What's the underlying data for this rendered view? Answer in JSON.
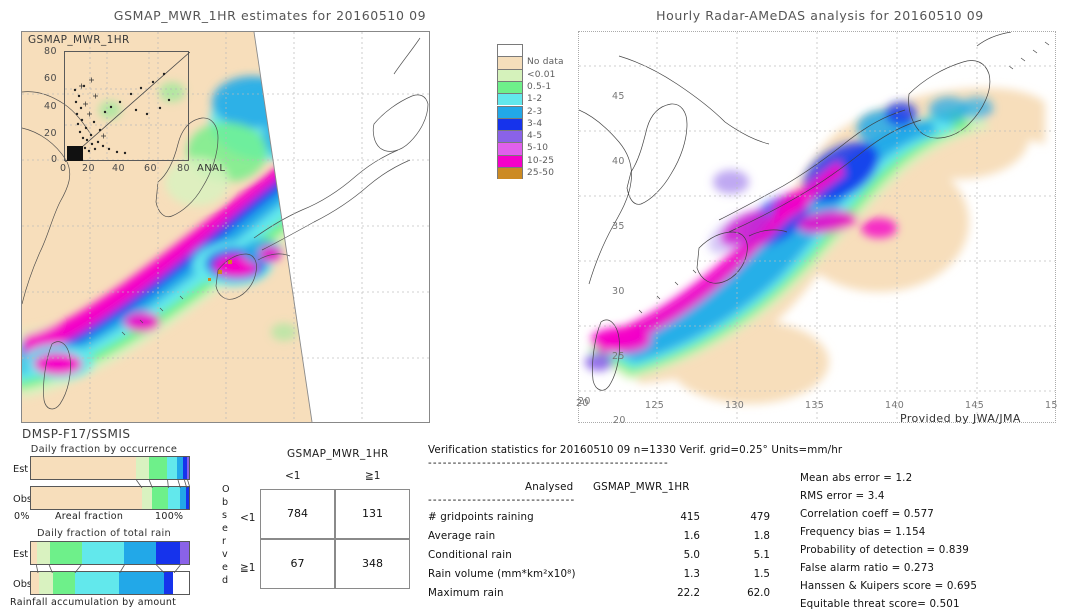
{
  "left_panel": {
    "title": "GSMAP_MWR_1HR estimates for 20160510 09",
    "inset_label": "GSMAP_MWR_1HR",
    "inset_xlabel": "ANAL",
    "inset_yticks": [
      "80",
      "60",
      "40",
      "20",
      "0"
    ],
    "inset_xticks": [
      "0",
      "20",
      "40",
      "60",
      "80"
    ],
    "sensor": "DMSP-F17/SSMIS"
  },
  "right_panel": {
    "title": "Hourly Radar-AMeDAS analysis for 20160510 09",
    "credit": "Provided by JWA/JMA",
    "lon_ticks": [
      "20",
      "125",
      "130",
      "135",
      "140",
      "145",
      "15"
    ],
    "lat_ticks": [
      "45",
      "40",
      "35",
      "30",
      "25",
      "20"
    ],
    "lat_bottom_extra": "20"
  },
  "colorbar": {
    "units": "mm/hr",
    "entries": [
      {
        "label": "",
        "color": "#ffffff"
      },
      {
        "label": "No data",
        "color": "#f5debb"
      },
      {
        "label": "<0.01",
        "color": "#d5f2bb"
      },
      {
        "label": "0.5-1",
        "color": "#6ef08a"
      },
      {
        "label": "1-2",
        "color": "#62e8ec"
      },
      {
        "label": "2-3",
        "color": "#22a8e8"
      },
      {
        "label": "3-4",
        "color": "#1633ec"
      },
      {
        "label": "4-5",
        "color": "#8a62e8"
      },
      {
        "label": "5-10",
        "color": "#e060ec"
      },
      {
        "label": "10-25",
        "color": "#f500c8"
      },
      {
        "label": "25-50",
        "color": "#cc8a22"
      }
    ]
  },
  "daily_fraction_occurrence": {
    "title": "Daily fraction by occurrence",
    "axis_left": "0%",
    "axis_center": "Areal fraction",
    "axis_right": "100%",
    "rows": [
      {
        "label": "Est",
        "segments": [
          {
            "color": "#f7debb",
            "width": 66.5
          },
          {
            "color": "#d9f2c0",
            "width": 8.0
          },
          {
            "color": "#6ef08a",
            "width": 11.5
          },
          {
            "color": "#62e8ec",
            "width": 6.5
          },
          {
            "color": "#22a8e8",
            "width": 4.0
          },
          {
            "color": "#1633ec",
            "width": 2.0
          },
          {
            "color": "#8a62e8",
            "width": 1.5
          }
        ]
      },
      {
        "label": "Obs",
        "segments": [
          {
            "color": "#f7debb",
            "width": 70.0
          },
          {
            "color": "#d9f2c0",
            "width": 6.5
          },
          {
            "color": "#6ef08a",
            "width": 10.0
          },
          {
            "color": "#62e8ec",
            "width": 7.5
          },
          {
            "color": "#22a8e8",
            "width": 4.0
          },
          {
            "color": "#1633ec",
            "width": 2.0
          }
        ]
      }
    ]
  },
  "daily_fraction_total_rain": {
    "title": "Daily fraction of total rain",
    "axis_bottom": "Rainfall accumulation by amount",
    "rows": [
      {
        "label": "Est",
        "segments": [
          {
            "color": "#f7debb",
            "width": 4.0
          },
          {
            "color": "#d9f2c0",
            "width": 8.0
          },
          {
            "color": "#6ef08a",
            "width": 20.0
          },
          {
            "color": "#62e8ec",
            "width": 27.0
          },
          {
            "color": "#22a8e8",
            "width": 20.0
          },
          {
            "color": "#1633ec",
            "width": 15.0
          },
          {
            "color": "#8a62e8",
            "width": 6.0
          }
        ]
      },
      {
        "label": "Obs",
        "segments": [
          {
            "color": "#f7debb",
            "width": 5.0
          },
          {
            "color": "#d9f2c0",
            "width": 9.0
          },
          {
            "color": "#6ef08a",
            "width": 14.0
          },
          {
            "color": "#62e8ec",
            "width": 28.0
          },
          {
            "color": "#22a8e8",
            "width": 28.0
          },
          {
            "color": "#1633ec",
            "width": 6.0
          }
        ]
      }
    ]
  },
  "contingency": {
    "title": "GSMAP_MWR_1HR",
    "col_headers": [
      "<1",
      "≧1"
    ],
    "row_headers": [
      "<1",
      "≧1"
    ],
    "side_label": "Observed",
    "cells": [
      [
        "784",
        "131"
      ],
      [
        "67",
        "348"
      ]
    ]
  },
  "verification": {
    "header": "Verification statistics for 20160510 09   n=1330  Verif. grid=0.25°  Units=mm/hr",
    "divider": "-------------------------------------------------",
    "col_header_analysed": "Analysed",
    "col_header_model": "GSMAP_MWR_1HR",
    "sub_divider": "------------------------------",
    "rows": [
      {
        "label": "# gridpoints raining",
        "analysed": "415",
        "model": "479"
      },
      {
        "label": "Average rain",
        "analysed": "1.6",
        "model": "1.8"
      },
      {
        "label": "Conditional rain",
        "analysed": "5.0",
        "model": "5.1"
      },
      {
        "label": "Rain volume (mm*km²x10⁸)",
        "analysed": "1.3",
        "model": "1.5"
      },
      {
        "label": "Maximum rain",
        "analysed": "22.2",
        "model": "62.0"
      }
    ],
    "scores": [
      "Mean abs error = 1.2",
      "RMS error = 3.4",
      "Correlation coeff = 0.577",
      "Frequency bias = 1.154",
      "Probability of detection = 0.839",
      "False alarm ratio = 0.273",
      "Hanssen & Kuipers score = 0.695",
      "Equitable threat score= 0.501"
    ]
  },
  "chart_data": {
    "type": "heatmap",
    "title": "GSMaP MWR 1HR vs Radar-AMeDAS precipitation verification, 20160510 09 UTC",
    "units": "mm/hr",
    "panels": [
      {
        "name": "GSMAP_MWR_1HR estimates",
        "kind": "map",
        "lon_range": [
          118,
          150
        ],
        "lat_range": [
          18,
          48
        ]
      },
      {
        "name": "Hourly Radar-AMeDAS analysis",
        "kind": "map",
        "lon_range": [
          120,
          150
        ],
        "lat_range": [
          20,
          48
        ]
      }
    ],
    "colorbar_levels": [
      "No data",
      "<0.01",
      "0.5-1",
      "1-2",
      "2-3",
      "3-4",
      "4-5",
      "5-10",
      "10-25",
      "25-50"
    ],
    "scatter_inset": {
      "xlabel": "ANAL",
      "ylabel": "GSMAP_MWR_1HR",
      "xlim": [
        0,
        80
      ],
      "ylim": [
        0,
        80
      ]
    },
    "contingency_table": {
      "rows": [
        "<1",
        ">=1"
      ],
      "cols": [
        "<1",
        ">=1"
      ],
      "values": [
        [
          784,
          131
        ],
        [
          67,
          348
        ]
      ]
    },
    "statistics": {
      "n": 1330,
      "verif_grid_deg": 0.25,
      "gridpoints_raining": {
        "analysed": 415,
        "model": 479
      },
      "average_rain": {
        "analysed": 1.6,
        "model": 1.8
      },
      "conditional_rain": {
        "analysed": 5.0,
        "model": 5.1
      },
      "rain_volume": {
        "analysed": 1.3,
        "model": 1.5
      },
      "maximum_rain": {
        "analysed": 22.2,
        "model": 62.0
      },
      "mean_abs_error": 1.2,
      "rms_error": 3.4,
      "correlation_coeff": 0.577,
      "frequency_bias": 1.154,
      "probability_of_detection": 0.839,
      "false_alarm_ratio": 0.273,
      "hanssen_kuipers": 0.695,
      "equitable_threat": 0.501
    }
  }
}
